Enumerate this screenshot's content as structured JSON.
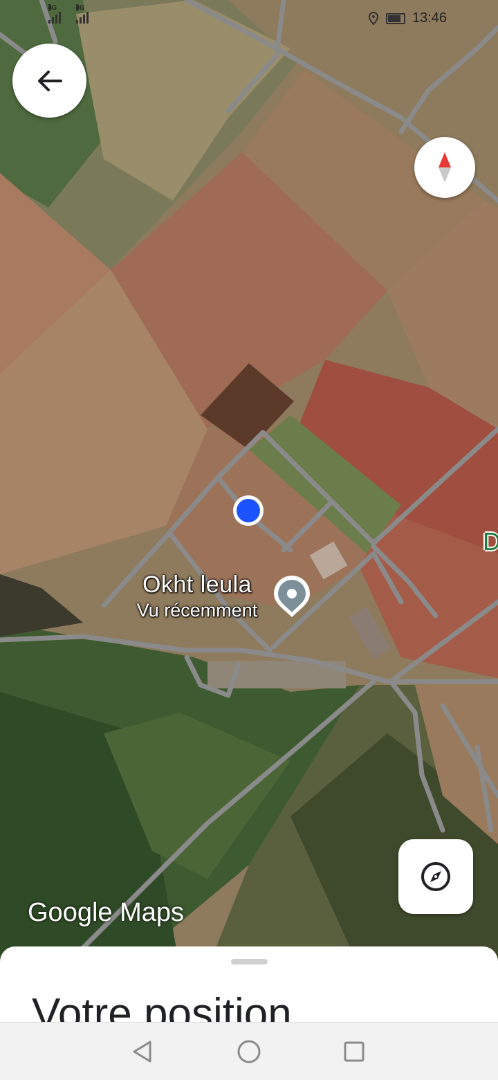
{
  "status_bar": {
    "network1": "4G",
    "network2": "4G",
    "time": "13:46"
  },
  "map": {
    "place_name": "Okht leula",
    "place_subtitle": "Vu récemment",
    "partial_label": "D",
    "watermark_google": "Google",
    "watermark_maps": "Maps"
  },
  "sheet": {
    "title": "Votre position"
  },
  "icons": {
    "back": "arrow-left-icon",
    "compass": "compass-needle-icon",
    "recenter": "compass-icon",
    "nav_back": "triangle-back-icon",
    "nav_home": "circle-home-icon",
    "nav_recents": "square-recents-icon"
  },
  "colors": {
    "location_dot": "#1a53ff",
    "road": "#8a8a8a",
    "compass_red": "#e53935"
  }
}
